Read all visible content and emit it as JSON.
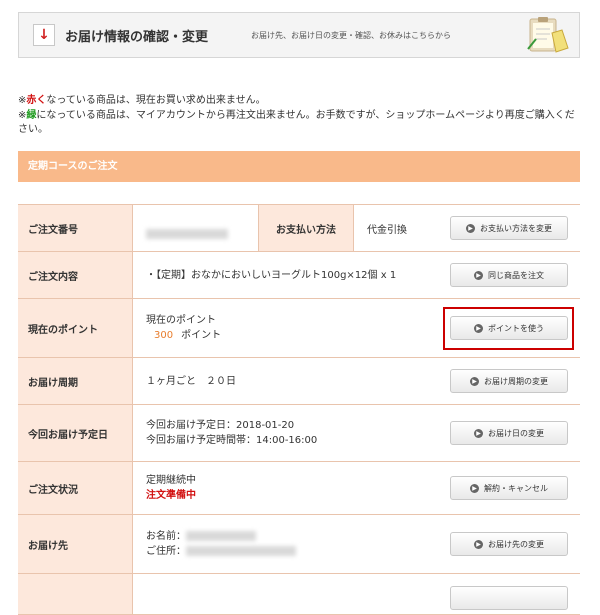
{
  "header": {
    "title": "お届け情報の確認・変更",
    "description": "お届け先、お届け日の変更・確認、お休みはこちらから"
  },
  "notes": {
    "line1_prefix": "※",
    "line1_red": "赤く",
    "line1_rest": "なっている商品は、現在お買い求め出来ません。",
    "line2_prefix": "※",
    "line2_green": "緑",
    "line2_rest": "になっている商品は、マイアカウントから再注文出来ません。お手数ですが、ショップホームページより再度ご購入ください。"
  },
  "course_title": "定期コースのご注文",
  "order": {
    "number_label": "ご注文番号",
    "payment_label": "お支払い方法",
    "payment_value": "代金引換",
    "payment_button": "お支払い方法を変更"
  },
  "contents": {
    "label": "ご注文内容",
    "value": "・【定期】おなかにおいしいヨーグルト100g×12個 x 1",
    "button": "同じ商品を注文"
  },
  "points": {
    "label": "現在のポイント",
    "line1": "現在のポイント",
    "amount": "300",
    "unit": "ポイント",
    "button": "ポイントを使う"
  },
  "cycle": {
    "label": "お届け周期",
    "value": "１ヶ月ごと　２０日",
    "button": "お届け周期の変更"
  },
  "next": {
    "label": "今回お届け予定日",
    "date": "今回お届け予定日：2018-01-20",
    "time": "今回お届け予定時間帯：14:00-16:00",
    "button": "お届け日の変更"
  },
  "status": {
    "label": "ご注文状況",
    "line1": "定期継続中",
    "line2": "注文準備中",
    "button": "解約・キャンセル"
  },
  "address": {
    "label": "お届け先",
    "name_label": "お名前：",
    "address_label": "ご住所：",
    "button": "お届け先の変更"
  },
  "colors": {
    "accent_orange": "#f9b98a",
    "label_bg": "#fde8dc",
    "highlight_red": "#cc0000"
  }
}
